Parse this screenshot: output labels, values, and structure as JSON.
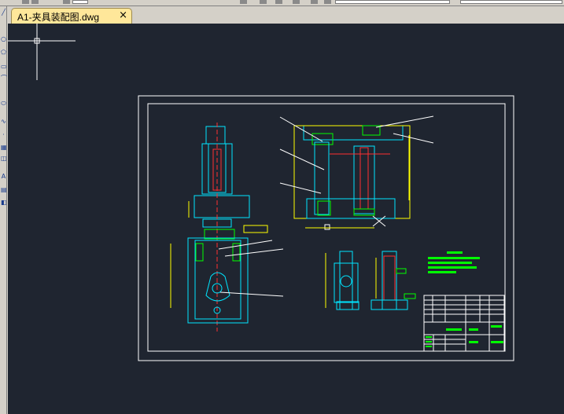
{
  "window": {
    "document_tab": {
      "label": "A1-夹具装配图.dwg",
      "close_glyph": "×"
    }
  },
  "toolbar": {
    "icons": [
      "undo-icon",
      "redo-icon",
      "print-icon",
      "open-icon",
      "save-icon"
    ]
  },
  "left_toolbar": {
    "icons": [
      "line-icon",
      "circle-icon",
      "polygon-icon",
      "rectangle-icon",
      "arc-icon",
      "ellipse-icon",
      "spline-icon",
      "point-icon",
      "hatch-icon",
      "region-icon",
      "text-icon",
      "table-icon",
      "block-icon"
    ]
  },
  "drawing": {
    "sheet": "A1",
    "title_block": {
      "highlight_color": "#00ff00"
    },
    "colors": {
      "canvas_bg": "#1f2530",
      "border": "#ffffff",
      "part": "#00e5ff",
      "dimension": "#ffff00",
      "hatch": "#00ff00",
      "centerline": "#ff3030",
      "leader": "#ffffff"
    }
  }
}
